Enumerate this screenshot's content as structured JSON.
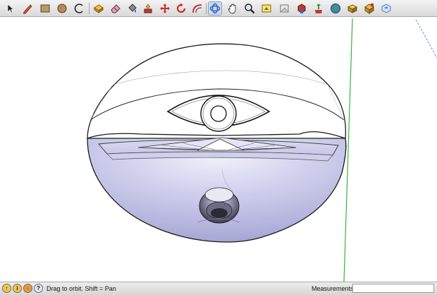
{
  "toolbar": {
    "tools": [
      {
        "icon": "select-arrow-icon"
      },
      {
        "icon": "pencil-line-icon"
      },
      {
        "icon": "rectangle-icon"
      },
      {
        "icon": "circle-icon"
      },
      {
        "icon": "arc-icon"
      },
      {
        "icon": "make-component-icon"
      },
      {
        "icon": "eraser-icon"
      },
      {
        "icon": "paint-bucket-icon"
      },
      {
        "icon": "push-pull-icon"
      },
      {
        "icon": "move-icon"
      },
      {
        "icon": "rotate-icon"
      },
      {
        "icon": "offset-icon"
      },
      {
        "icon": "orbit-icon",
        "active": true
      },
      {
        "icon": "pan-hand-icon"
      },
      {
        "icon": "zoom-icon"
      },
      {
        "icon": "zoom-extents-icon"
      },
      {
        "icon": "previous-view-icon"
      },
      {
        "icon": "get-models-icon"
      },
      {
        "icon": "share-model-icon"
      },
      {
        "icon": "get-photo-texture-icon"
      },
      {
        "icon": "add-location-icon"
      },
      {
        "icon": "components-icon"
      },
      {
        "icon": "extension-warehouse-icon"
      }
    ]
  },
  "viewport": {
    "model": "sphere-with-eye-dome",
    "colors": {
      "background": "#ffffff",
      "dome_face": "#ffffff",
      "bowl_shade_light": "#e4e4f5",
      "bowl_shade_dark": "#a3a3d3",
      "edge": "#000000",
      "green_axis": "#3cb13c",
      "blue_axis_dashed": "#6a8fd8"
    }
  },
  "statusbar": {
    "icons": [
      "geo-location-icon",
      "credits-icon",
      "user-icon",
      "help-icon"
    ],
    "hint": "Drag to orbit.  Shift = Pan",
    "measurements_label": "Measurements",
    "measurements_value": ""
  }
}
